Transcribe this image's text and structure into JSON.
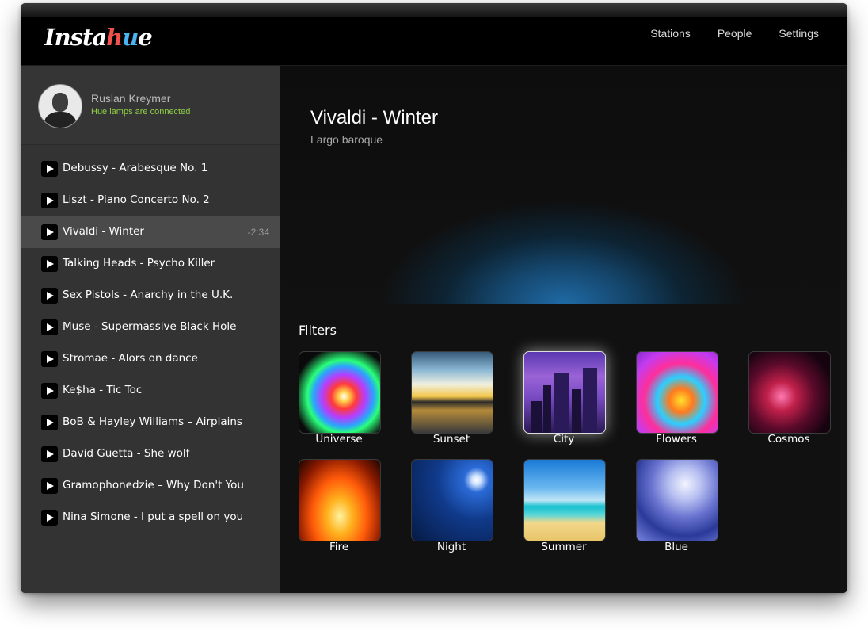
{
  "app": {
    "logo_text": "Instahue"
  },
  "nav": {
    "items": [
      {
        "label": "Stations"
      },
      {
        "label": "People"
      },
      {
        "label": "Settings"
      }
    ]
  },
  "profile": {
    "name": "Ruslan Kreymer",
    "status": "Hue lamps are connected",
    "status_color": "#8fcf46"
  },
  "tracks": [
    {
      "title": "Debussy - Arabesque No. 1",
      "time": ""
    },
    {
      "title": "Liszt - Piano Concerto No. 2",
      "time": ""
    },
    {
      "title": "Vivaldi - Winter",
      "time": "-2:34",
      "active": true
    },
    {
      "title": "Talking Heads - Psycho Killer",
      "time": ""
    },
    {
      "title": "Sex Pistols - Anarchy in the U.K.",
      "time": ""
    },
    {
      "title": "Muse - Supermassive Black Hole",
      "time": ""
    },
    {
      "title": "Stromae - Alors on dance",
      "time": ""
    },
    {
      "title": "Ke$ha - Tic Toc",
      "time": ""
    },
    {
      "title": "BoB & Hayley Williams – Airplains",
      "time": ""
    },
    {
      "title": "David Guetta - She wolf",
      "time": ""
    },
    {
      "title": "Gramophonedzie – Why Don't You",
      "time": ""
    },
    {
      "title": "Nina Simone - I put a spell on you",
      "time": ""
    }
  ],
  "now_playing": {
    "title": "Vivaldi - Winter",
    "subtitle": "Largo baroque"
  },
  "filters": {
    "title": "Filters",
    "items": [
      {
        "label": "Universe"
      },
      {
        "label": "Sunset"
      },
      {
        "label": "City",
        "selected": true
      },
      {
        "label": "Flowers"
      },
      {
        "label": "Cosmos"
      },
      {
        "label": "Fire"
      },
      {
        "label": "Night"
      },
      {
        "label": "Summer"
      },
      {
        "label": "Blue"
      }
    ]
  }
}
